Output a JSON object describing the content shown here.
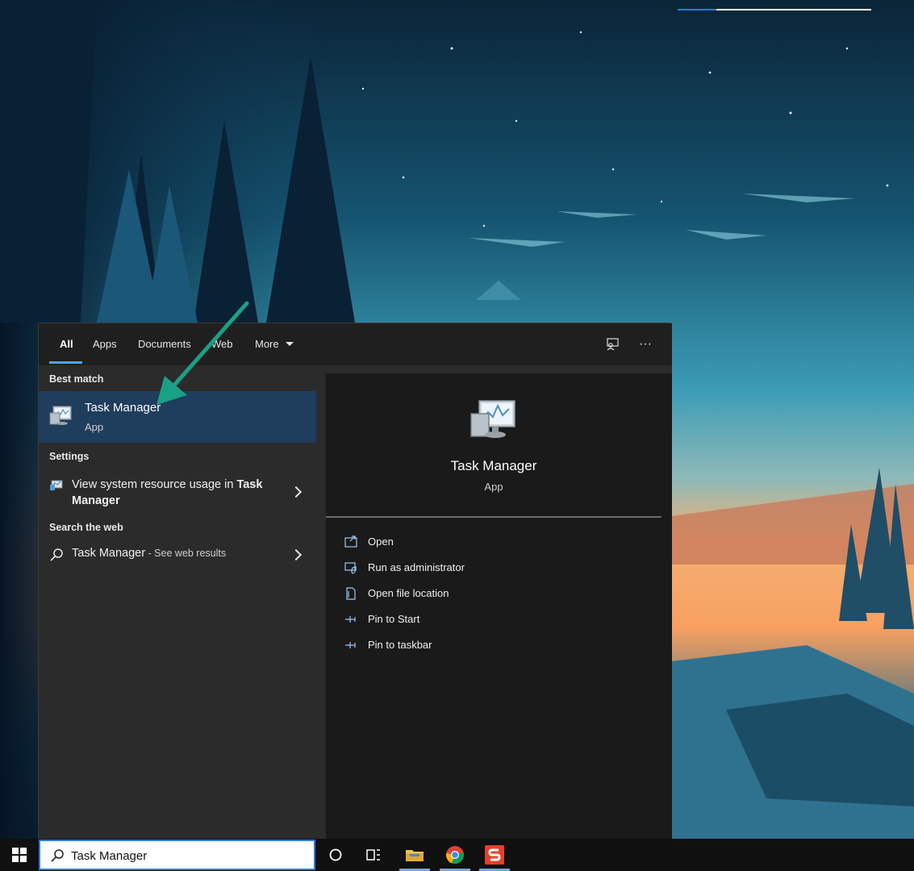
{
  "flyout": {
    "tabs": {
      "all": "All",
      "apps": "Apps",
      "documents": "Documents",
      "web": "Web",
      "more": "More"
    },
    "ellipsis": "···"
  },
  "left": {
    "best_match_header": "Best match",
    "best_match": {
      "title": "Task Manager",
      "subtitle": "App"
    },
    "settings_header": "Settings",
    "setting_item": {
      "text_plain": "View system resource usage in ",
      "text_bold": "Task Manager"
    },
    "web_header": "Search the web",
    "web_item": {
      "title": "Task Manager",
      "subtitle": " - See web results"
    }
  },
  "right": {
    "title": "Task Manager",
    "subtitle": "App",
    "actions": [
      {
        "label": "Open",
        "icon": "open-window-icon"
      },
      {
        "label": "Run as administrator",
        "icon": "shield-admin-icon"
      },
      {
        "label": "Open file location",
        "icon": "file-location-icon"
      },
      {
        "label": "Pin to Start",
        "icon": "pin-icon"
      },
      {
        "label": "Pin to taskbar",
        "icon": "pin-icon"
      }
    ]
  },
  "taskbar": {
    "search_value": "Task Manager",
    "apps": [
      "cortana-icon",
      "task-view-icon",
      "file-explorer-icon",
      "chrome-icon",
      "s-app-icon"
    ]
  },
  "colors": {
    "accent": "#4da3ff",
    "selected_row": "#1f3d5c",
    "annotation_arrow": "#1aa085"
  }
}
